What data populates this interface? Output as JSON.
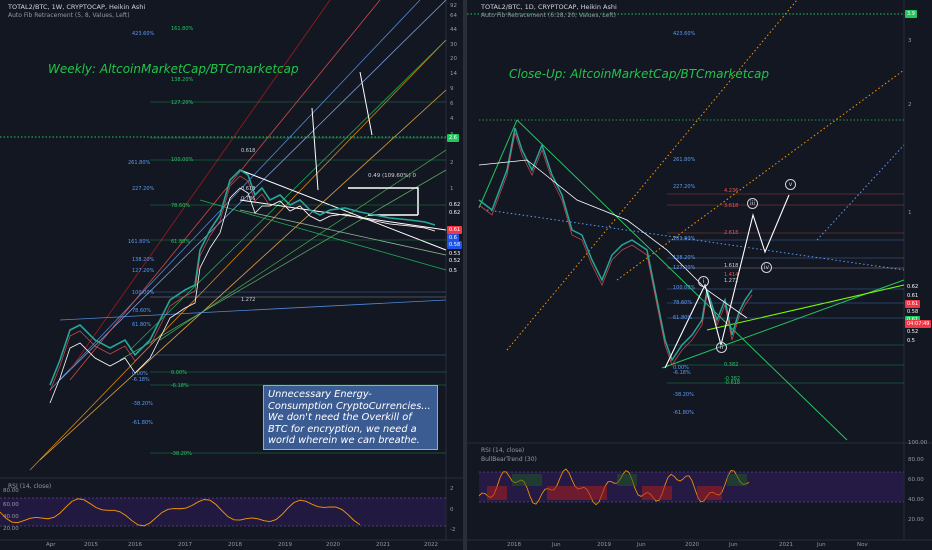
{
  "left_panel": {
    "symbol": "TOTAL2/BTC, 1W, CRYPTOCAP, Heikin Ashi",
    "indicator": "Auto Fib Retracement (5, 8, Values, Left)",
    "note": "Weekly: AltcoinMarketCap/BTCmarketcap",
    "annotation": "0.49 (109.60%) 0",
    "fib_labels": [
      {
        "t": "423.60%",
        "c": "b"
      },
      {
        "t": "161.80%",
        "c": "g"
      },
      {
        "t": "138.20%",
        "c": "g"
      },
      {
        "t": "127.20%",
        "c": "g"
      },
      {
        "t": "261.80%",
        "c": "b"
      },
      {
        "t": "100.00%",
        "c": "g"
      },
      {
        "t": "227.20%",
        "c": "b"
      },
      {
        "t": "78.60%",
        "c": "g"
      },
      {
        "t": "161.80%",
        "c": "b"
      },
      {
        "t": "61.80%",
        "c": "g"
      },
      {
        "t": "138.20%",
        "c": "b"
      },
      {
        "t": "127.20%",
        "c": "b"
      },
      {
        "t": "100.00%",
        "c": "b"
      },
      {
        "t": "78.60%",
        "c": "b"
      },
      {
        "t": "61.80%",
        "c": "b"
      },
      {
        "t": "0.00%",
        "c": "g"
      },
      {
        "t": "0.00%",
        "c": "b"
      },
      {
        "t": "-6.18%",
        "c": "g"
      },
      {
        "t": "-6.18%",
        "c": "b"
      },
      {
        "t": "-38.20%",
        "c": "b"
      },
      {
        "t": "-61.80%",
        "c": "b"
      },
      {
        "t": "-38.20%",
        "c": "g"
      },
      {
        "t": "0.618",
        "c": "w"
      },
      {
        "t": "0.618",
        "c": "w"
      },
      {
        "t": "0.786",
        "c": "w"
      },
      {
        "t": "1.272",
        "c": "w"
      }
    ],
    "y_ticks": [
      "92",
      "64",
      "44",
      "30",
      "20",
      "14",
      "9",
      "6",
      "4",
      "3",
      "2",
      "1",
      "0.5"
    ],
    "price_badges": [
      {
        "t": "2.6",
        "color": "#22c55e"
      },
      {
        "t": "0.62",
        "color": "#131722"
      },
      {
        "t": "0.62",
        "color": "#131722"
      },
      {
        "t": "0.61",
        "color": "#f23645"
      },
      {
        "t": "0.6",
        "color": "#1e53e5"
      },
      {
        "t": "0.58",
        "color": "#1e53e5"
      },
      {
        "t": "0.53",
        "color": "#131722"
      },
      {
        "t": "0.52",
        "color": "#131722"
      },
      {
        "t": "0.5",
        "color": "#131722"
      }
    ],
    "rsi_label": "RSI (14, close)",
    "rsi_ticks": [
      "80.00",
      "60.00",
      "40.00",
      "20.00"
    ],
    "rsi_right_ticks": [
      "2",
      "0",
      "-2"
    ],
    "x_ticks": [
      "Apr",
      "2015",
      "2016",
      "2017",
      "2018",
      "2019",
      "2020",
      "2021",
      "2022"
    ]
  },
  "right_panel": {
    "symbol": "TOTAL2/BTC, 1D, CRYPTOCAP, Heikin Ashi",
    "indicator": "Auto Fib Retracement (6.18, 20, Values, Left)",
    "note": "Close-Up: AltcoinMarketCap/BTCmarketcap",
    "fib_labels": [
      {
        "t": "423.60%",
        "c": "b"
      },
      {
        "t": "261.80%",
        "c": "b"
      },
      {
        "t": "227.20%",
        "c": "b"
      },
      {
        "t": "161.80%",
        "c": "b"
      },
      {
        "t": "138.20%",
        "c": "b"
      },
      {
        "t": "127.20%",
        "c": "b"
      },
      {
        "t": "100.00%",
        "c": "b"
      },
      {
        "t": "78.60%",
        "c": "b"
      },
      {
        "t": "61.80%",
        "c": "b"
      },
      {
        "t": "0.00%",
        "c": "b"
      },
      {
        "t": "-6.18%",
        "c": "b"
      },
      {
        "t": "-38.20%",
        "c": "b"
      },
      {
        "t": "-61.80%",
        "c": "b"
      },
      {
        "t": "4.236",
        "c": "r"
      },
      {
        "t": "3.618",
        "c": "r"
      },
      {
        "t": "2.618",
        "c": "r"
      },
      {
        "t": "1.618",
        "c": "w"
      },
      {
        "t": "1.414",
        "c": "r"
      },
      {
        "t": "1.272",
        "c": "w"
      },
      {
        "t": "0.382",
        "c": "g"
      },
      {
        "t": "-0.382",
        "c": "g"
      },
      {
        "t": "-0.618",
        "c": "g"
      }
    ],
    "y_ticks": [
      "3",
      "2",
      "1"
    ],
    "price_badges": [
      {
        "t": "3.9",
        "color": "#22c55e"
      },
      {
        "t": "0.62",
        "color": "#131722"
      },
      {
        "t": "0.61",
        "color": "#131722"
      },
      {
        "t": "0.61",
        "color": "#f23645"
      },
      {
        "t": "0.58",
        "color": "#131722"
      },
      {
        "t": "0.61",
        "color": "#22c55e"
      },
      {
        "t": "04:07:49",
        "color": "#f23645"
      },
      {
        "t": "0.52",
        "color": "#131722"
      },
      {
        "t": "0.5",
        "color": "#131722"
      }
    ],
    "wave_labels": [
      "i",
      "ii",
      "iii",
      "iv",
      "v"
    ],
    "rsi_label": "RSI (14, close)",
    "bbt_label": "BullBearTrend (30)",
    "rsi_ticks": [
      "100.00",
      "80.00",
      "60.00",
      "40.00",
      "20.00"
    ],
    "x_ticks": [
      "2018",
      "Jun",
      "2019",
      "Jun",
      "2020",
      "Jun",
      "2021",
      "Jun",
      "Nov"
    ]
  },
  "text_box": "Unnecessary Energy-Consumption CryptoCurrencies... We don't need the Overkill of BTC for encryption, we need a world wherein we can breathe.",
  "colors": {
    "background": "#131722",
    "note_green": "#21c44a",
    "textbox_bg": "#3b5b93",
    "rsi_band": "#2a1b4e",
    "rsi_line": "#ff9800"
  },
  "chart_data": [
    {
      "type": "line",
      "series": [
        {
          "values": [
            0.9,
            0.6,
            0.55,
            0.8,
            1.8,
            2.3,
            2.0,
            1.5,
            0.62,
            0.55,
            0.61
          ]
        }
      ],
      "ylim": [
        0.5,
        92
      ],
      "log_scale": true
    },
    {
      "type": "line",
      "series": [
        {
          "values": [
            1.2,
            1.8,
            1.3,
            0.95,
            0.85,
            0.75,
            0.6,
            0.55,
            0.61
          ]
        }
      ],
      "ylim": [
        0.5,
        3.9
      ],
      "log_scale": true
    }
  ]
}
